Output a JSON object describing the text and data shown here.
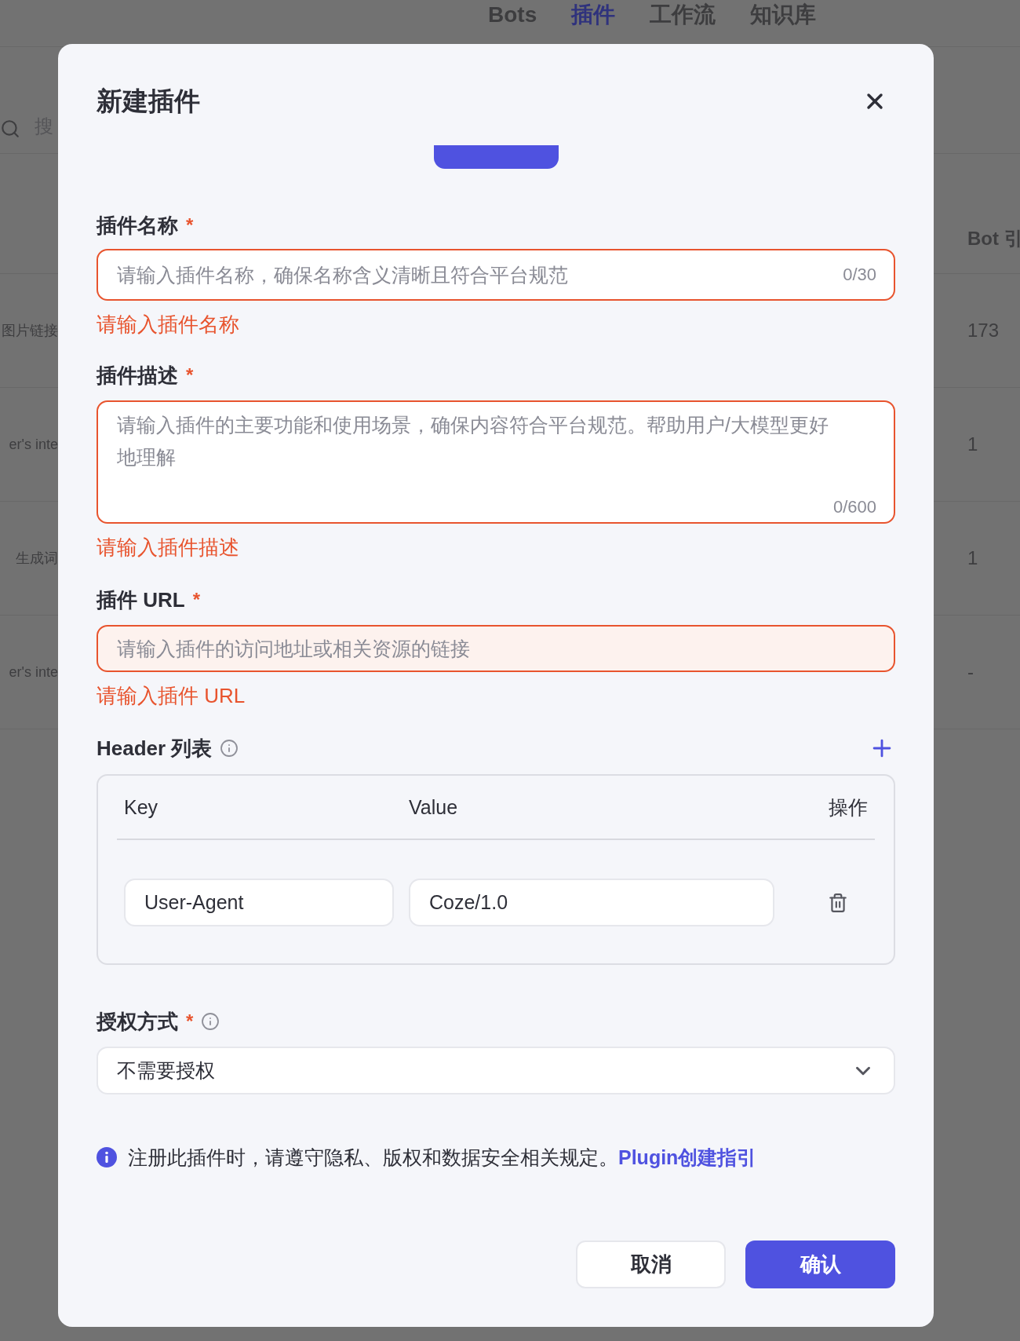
{
  "background": {
    "nav_tabs": [
      {
        "label": "Bots",
        "selected": false
      },
      {
        "label": "插件",
        "selected": true
      },
      {
        "label": "工作流",
        "selected": false
      },
      {
        "label": "知识库",
        "selected": false
      }
    ],
    "search": {
      "placeholder": "搜"
    },
    "table": {
      "column_header": "Bot 引",
      "rows": [
        {
          "column_1": "图片链接",
          "column_2": "173"
        },
        {
          "column_1": "er's inte",
          "column_2": "1"
        },
        {
          "column_1": "生成词",
          "column_2": "1"
        },
        {
          "column_1": "er's inte",
          "column_2": "-"
        }
      ]
    }
  },
  "dialog": {
    "title": "新建插件",
    "fields": [
      {
        "kind": "input",
        "label": "插件名称",
        "required_mark": "*",
        "placeholder": "请输入插件名称，确保名称含义清晰且符合平台规范",
        "counter": "0/30",
        "error": "请输入插件名称",
        "focused": false
      },
      {
        "kind": "textarea",
        "label": "插件描述",
        "required_mark": "*",
        "placeholder": "请输入插件的主要功能和使用场景，确保内容符合平台规范。帮助用户/大模型更好地理解",
        "counter": "0/600",
        "error": "请输入插件描述",
        "focused": false
      },
      {
        "kind": "input",
        "label": "插件 URL",
        "required_mark": "*",
        "placeholder": "请输入插件的访问地址或相关资源的链接",
        "error": "请输入插件 URL",
        "focused": true
      }
    ],
    "headers": {
      "label": "Header 列表",
      "columns": [
        "Key",
        "Value",
        "操作"
      ],
      "rows": [
        {
          "key": "User-Agent",
          "value": "Coze/1.0"
        }
      ]
    },
    "auth": {
      "label": "授权方式",
      "required_mark": "*",
      "value": "不需要授权"
    },
    "notice": {
      "text": "注册此插件时，请遵守隐私、版权和数据安全相关规定。",
      "link": "Plugin创建指引"
    },
    "buttons": [
      {
        "label": "取消",
        "kind": "secondary"
      },
      {
        "label": "确认",
        "kind": "primary"
      }
    ]
  }
}
